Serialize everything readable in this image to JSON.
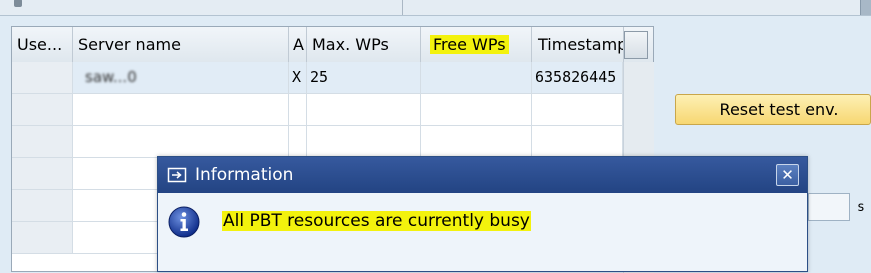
{
  "table": {
    "columns": [
      {
        "label": "Use...",
        "highlighted": false
      },
      {
        "label": "Server name",
        "highlighted": false
      },
      {
        "label": "A",
        "highlighted": false
      },
      {
        "label": "Max. WPs",
        "highlighted": false
      },
      {
        "label": "Free WPs",
        "highlighted": true
      },
      {
        "label": "Timestamp",
        "highlighted": false
      }
    ],
    "rows": [
      {
        "use": "",
        "server_name": "saw...0",
        "a": "X",
        "max_wps": "25",
        "free_wps": "",
        "timestamp": "635826445"
      }
    ]
  },
  "actions": {
    "reset_label": "Reset test env."
  },
  "side": {
    "unit_label": "s"
  },
  "dialog": {
    "title": "Information",
    "message": "All PBT resources are currently busy",
    "close_symbol": "✕"
  },
  "colors": {
    "highlight": "#f3f20d",
    "dialog_title_bar": "#2c4f8e",
    "button_yellow": "#f7d772"
  }
}
